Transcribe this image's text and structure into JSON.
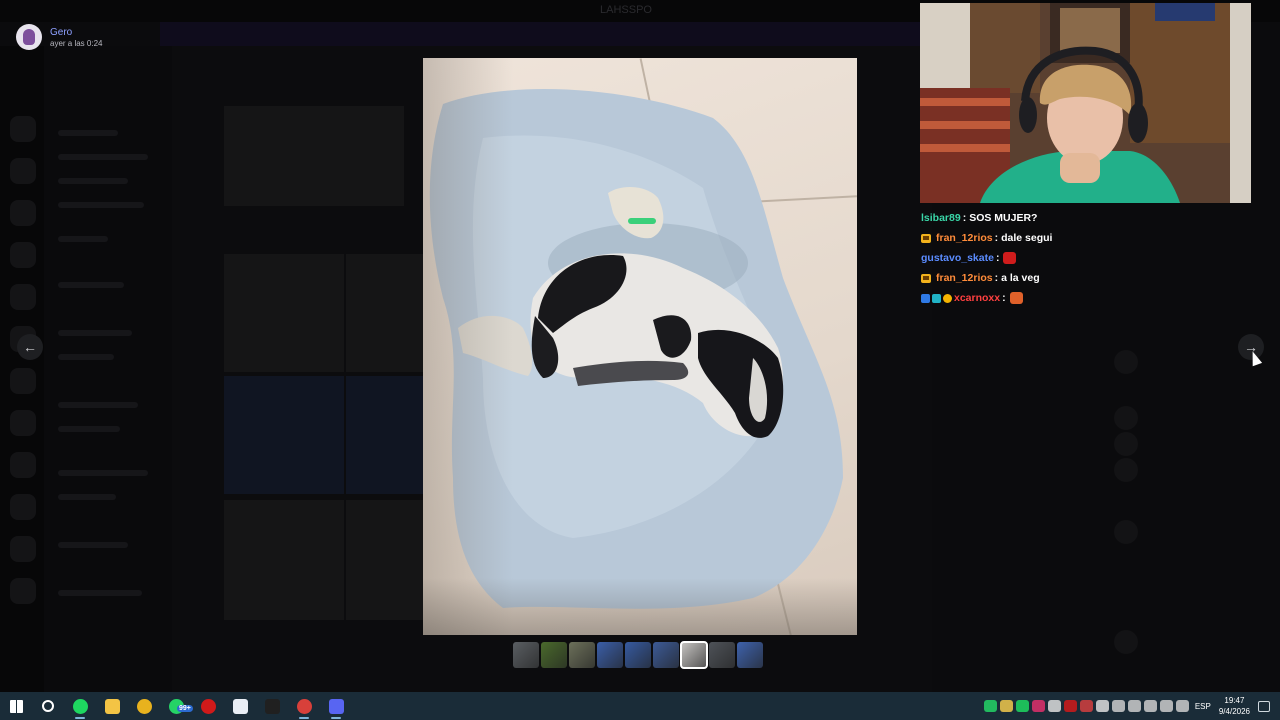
{
  "window": {
    "title": "LAHSSPO"
  },
  "viewer": {
    "author": "Gero",
    "timestamp": "ayer a las 0:24"
  },
  "nav": {
    "prev_icon": "←",
    "next_icon": "→"
  },
  "thumbnails": [
    {
      "id": 1,
      "color": "#5a5e62"
    },
    {
      "id": 2,
      "color": "#4a6a2c"
    },
    {
      "id": 3,
      "color": "#6c705a"
    },
    {
      "id": 4,
      "color": "#3a5ea8"
    },
    {
      "id": 5,
      "color": "#365aa0"
    },
    {
      "id": 6,
      "color": "#3c5a96"
    },
    {
      "id": 7,
      "color": "#c8c6c4"
    },
    {
      "id": 8,
      "color": "#4e5258"
    },
    {
      "id": 9,
      "color": "#3e62ac"
    }
  ],
  "stream_chat": [
    {
      "user": "lsibar89",
      "user_color": "#3ad7a8",
      "badges": [],
      "text": "SOS MUJER?"
    },
    {
      "user": "fran_12rios",
      "user_color": "#ff8c3a",
      "badges": [
        "crown"
      ],
      "text": "dale segui"
    },
    {
      "user": "gustavo_skate",
      "user_color": "#5b8cff",
      "badges": [],
      "text": "",
      "emote": "#d01c1c"
    },
    {
      "user": "fran_12rios",
      "user_color": "#ff8c3a",
      "badges": [
        "crown"
      ],
      "text": "a la veg"
    },
    {
      "user": "xcarnoxx",
      "user_color": "#ff4040",
      "badges": [
        "blue",
        "teal",
        "gold"
      ],
      "text": "",
      "emote": "#e0612a"
    }
  ],
  "taskbar": {
    "apps": [
      {
        "name": "windows-start-icon",
        "color": "#ffffff"
      },
      {
        "name": "search-icon",
        "color": "#ffffff"
      },
      {
        "name": "spotify-icon",
        "color": "#1ed760",
        "open": true
      },
      {
        "name": "file-explorer-icon",
        "color": "#f3c445"
      },
      {
        "name": "chrome-icon",
        "color": "#e8b21e"
      },
      {
        "name": "whatsapp-icon",
        "color": "#25d366",
        "badge": "99+"
      },
      {
        "name": "record-icon",
        "color": "#d01a1a"
      },
      {
        "name": "store-icon",
        "color": "#e9eef5"
      },
      {
        "name": "obs-icon",
        "color": "#202020"
      },
      {
        "name": "chrome-alt-icon",
        "color": "#d8403a",
        "open": true
      },
      {
        "name": "discord-icon",
        "color": "#5865f2",
        "open": true
      }
    ],
    "tray_icons": [
      "#25d366",
      "#f2c94c",
      "#1ed760",
      "#e1306c",
      "#dddddd",
      "#d01a1a",
      "#d33f3f",
      "#dddddd",
      "#cccccc",
      "#cccccc",
      "#cccccc",
      "#cccccc",
      "#cccccc"
    ],
    "language": "ESP",
    "time": "19:47",
    "date": "9/4/2026"
  }
}
